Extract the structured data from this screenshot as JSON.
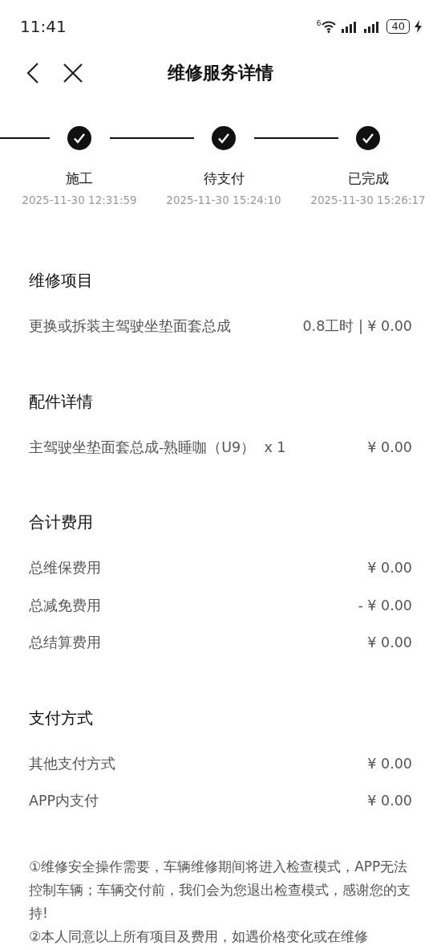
{
  "status_bar": {
    "time": "11:41",
    "wifi_badge": "6",
    "battery": "40",
    "charging": true
  },
  "header": {
    "title": "维修服务详情"
  },
  "steps": [
    {
      "label": "施工",
      "time": "2025-11-30 12:31:59",
      "done": true
    },
    {
      "label": "待支付",
      "time": "2025-11-30 15:24:10",
      "done": true
    },
    {
      "label": "已完成",
      "time": "2025-11-30 15:26:17",
      "done": true
    }
  ],
  "sections": [
    {
      "title": "维修项目",
      "rows": [
        {
          "label": "更换或拆装主驾驶坐垫面套总成",
          "value": "0.8工时 | ¥ 0.00"
        }
      ]
    },
    {
      "title": "配件详情",
      "rows": [
        {
          "label": "主驾驶坐垫面套总成-熟睡咖（U9）  x 1",
          "value": "¥ 0.00"
        }
      ]
    },
    {
      "title": "合计费用",
      "rows": [
        {
          "label": "总维保费用",
          "value": "¥ 0.00"
        },
        {
          "label": "总减免费用",
          "value": "- ¥ 0.00"
        },
        {
          "label": "总结算费用",
          "value": "¥ 0.00"
        }
      ]
    },
    {
      "title": "支付方式",
      "rows": [
        {
          "label": "其他支付方式",
          "value": "¥ 0.00"
        },
        {
          "label": "APP内支付",
          "value": "¥ 0.00"
        }
      ]
    }
  ],
  "notes": [
    "①维修安全操作需要，车辆维修期间将进入检查模式，APP无法控制车辆；车辆交付前，我们会为您退出检查模式，感谢您的支持!",
    "②本人同意以上所有项目及费用，如遇价格变化或在维修"
  ]
}
